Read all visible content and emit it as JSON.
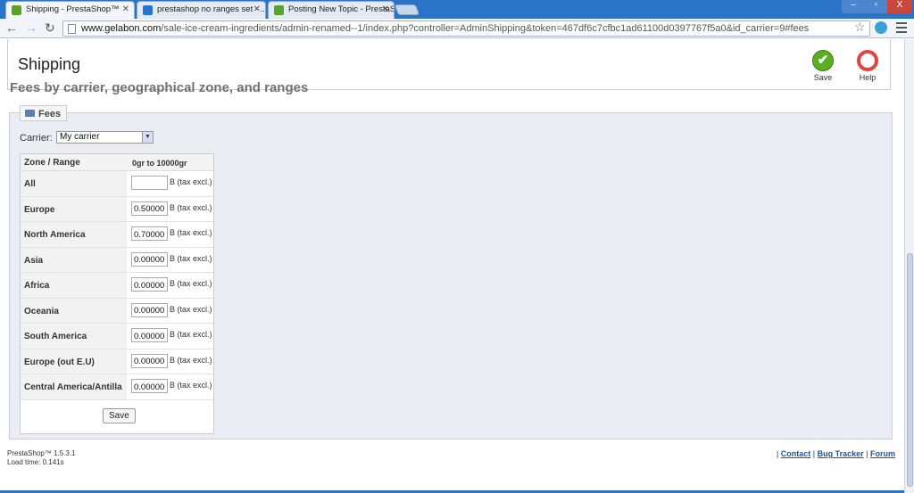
{
  "browser": {
    "tabs": [
      {
        "label": "Shipping - PrestaShop™",
        "active": true,
        "favicon_color": "#5aa329"
      },
      {
        "label": "prestashop no ranges set - ...",
        "active": false,
        "favicon_color": "#2a73c7"
      },
      {
        "label": "Posting New Topic - PrestaSh",
        "active": false,
        "favicon_color": "#5aa329"
      }
    ],
    "url_host": "www.gelabon.com",
    "url_path": "/sale-ice-cream-ingredients/admin-renamed--1/index.php?controller=AdminShipping&token=467df6c7cfbc1ad61100d0397767f5a0&id_carrier=9#fees",
    "window_buttons": {
      "min": "–",
      "max": "▫",
      "close": "X"
    }
  },
  "page": {
    "title": "Shipping",
    "subheading": "Fees by carrier, geographical zone, and ranges",
    "toolbar": {
      "save_label": "Save",
      "help_label": "Help"
    },
    "fees": {
      "legend": "Fees",
      "carrier_label": "Carrier:",
      "carrier_value": "My carrier",
      "table_header_zone": "Zone / Range",
      "table_header_range": "0gr to 10000gr",
      "rows": [
        {
          "zone": "All",
          "value": "",
          "unit": "B (tax excl.)"
        },
        {
          "zone": "Europe",
          "value": "0.50000",
          "unit": "B (tax excl.)"
        },
        {
          "zone": "North America",
          "value": "0.70000",
          "unit": "B (tax excl.)"
        },
        {
          "zone": "Asia",
          "value": "0.00000",
          "unit": "B (tax excl.)"
        },
        {
          "zone": "Africa",
          "value": "0.00000",
          "unit": "B (tax excl.)"
        },
        {
          "zone": "Oceania",
          "value": "0.00000",
          "unit": "B (tax excl.)"
        },
        {
          "zone": "South America",
          "value": "0.00000",
          "unit": "B (tax excl.)"
        },
        {
          "zone": "Europe (out E.U)",
          "value": "0.00000",
          "unit": "B (tax excl.)"
        },
        {
          "zone": "Central America/Antilla",
          "value": "0.00000",
          "unit": "B (tax excl.)"
        }
      ],
      "save_button": "Save"
    },
    "footer": {
      "version": "PrestaShop™ 1.5.3.1",
      "load_time": "Load time: 0.141s",
      "links": {
        "contact": "Contact",
        "bug_tracker": "Bug Tracker",
        "forum": "Forum"
      },
      "separator": "|"
    }
  },
  "colors": {
    "accent_blue": "#2a73c7",
    "save_green": "#5cb020",
    "help_red": "#e4433a",
    "panel_bg": "#ebedf4"
  }
}
